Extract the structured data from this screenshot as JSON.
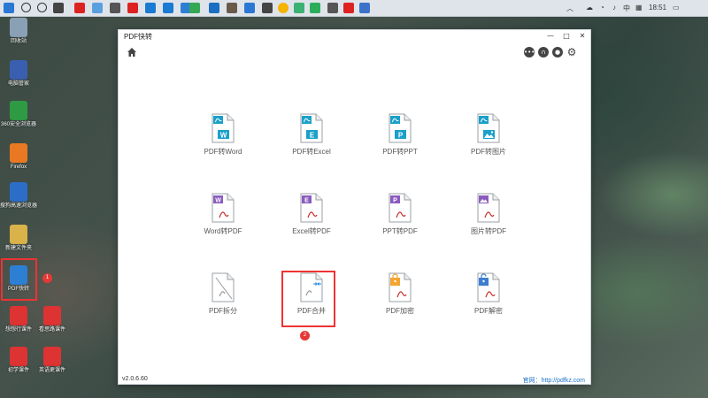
{
  "taskbar": {
    "time": "18:51",
    "ime": "中",
    "icons": [
      "search-icon",
      "task-view-icon",
      "app-icon"
    ]
  },
  "desktop": {
    "icons": [
      {
        "label": "回收站",
        "color": "#8aa0b5"
      },
      {
        "label": "电脑管家",
        "color": "#3a5fb0"
      },
      {
        "label": "360安全浏览器",
        "color": "#2e9a44"
      },
      {
        "label": "Firefox",
        "color": "#e87922"
      },
      {
        "label": "搜狗高速浏览器",
        "color": "#2c6dc8"
      },
      {
        "label": "新建文件夹",
        "color": "#d9b24a"
      },
      {
        "label": "PDF快转",
        "color": "#2d7fd3"
      },
      {
        "label": "想想行课件",
        "color": "#d33"
      },
      {
        "label": "看思路课件",
        "color": "#d33"
      },
      {
        "label": "初学课件",
        "color": "#d33"
      },
      {
        "label": "英语更课件",
        "color": "#d33"
      }
    ],
    "badge1": "1"
  },
  "window": {
    "title": "PDF快转",
    "minimize": "—",
    "maximize": "□",
    "close": "✕",
    "version": "v2.0.6.60",
    "website": "官网：http://pdfkz.com"
  },
  "tiles": [
    {
      "label": "PDF转Word",
      "letter": "W",
      "kind": "out"
    },
    {
      "label": "PDF转Excel",
      "letter": "E",
      "kind": "out"
    },
    {
      "label": "PDF转PPT",
      "letter": "P",
      "kind": "out"
    },
    {
      "label": "PDF转图片",
      "letter": "img",
      "kind": "out"
    },
    {
      "label": "Word转PDF",
      "letter": "W",
      "kind": "in"
    },
    {
      "label": "Excel转PDF",
      "letter": "E",
      "kind": "in"
    },
    {
      "label": "PPT转PDF",
      "letter": "P",
      "kind": "in"
    },
    {
      "label": "图片转PDF",
      "letter": "img",
      "kind": "in"
    },
    {
      "label": "PDF拆分",
      "letter": "",
      "kind": "split"
    },
    {
      "label": "PDF合并",
      "letter": "",
      "kind": "merge"
    },
    {
      "label": "PDF加密",
      "letter": "lock",
      "kind": "lock"
    },
    {
      "label": "PDF解密",
      "letter": "unlock",
      "kind": "unlock"
    }
  ],
  "badge2": "2",
  "colors": {
    "out": "#1aa0c9",
    "in": "#8a5bbf",
    "lock": "#f2a531",
    "unlock": "#3b7fd0",
    "gray": "#8a8f95",
    "highlight": "#e33333"
  }
}
